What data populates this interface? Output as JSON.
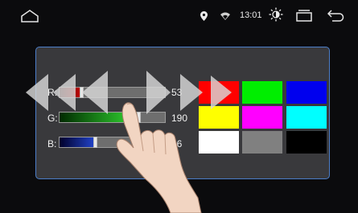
{
  "status_bar": {
    "time": "13:01",
    "icons": [
      "home-icon",
      "location-icon",
      "wifi-icon",
      "brightness-icon",
      "recent-apps-icon",
      "back-icon"
    ]
  },
  "sliders": [
    {
      "label": "R:",
      "value": "53",
      "value_num": 53,
      "max": 255,
      "fill_from": "#2a0000",
      "fill_to": "#cc0000"
    },
    {
      "label": "G:",
      "value": "190",
      "value_num": 190,
      "max": 255,
      "fill_from": "#002a00",
      "fill_to": "#33dd33"
    },
    {
      "label": "B:",
      "value": "86",
      "value_num": 86,
      "max": 255,
      "fill_from": "#00002a",
      "fill_to": "#2244cc"
    }
  ],
  "swatches": [
    "#ff0000",
    "#00ee00",
    "#0000ee",
    "#ffff00",
    "#ff00ff",
    "#00ffff",
    "#ffffff",
    "#808080",
    "#000000"
  ],
  "overlay_icons": [
    "rewind-arrows-icon",
    "fast-forward-arrows-icon",
    "pointing-hand-icon"
  ]
}
